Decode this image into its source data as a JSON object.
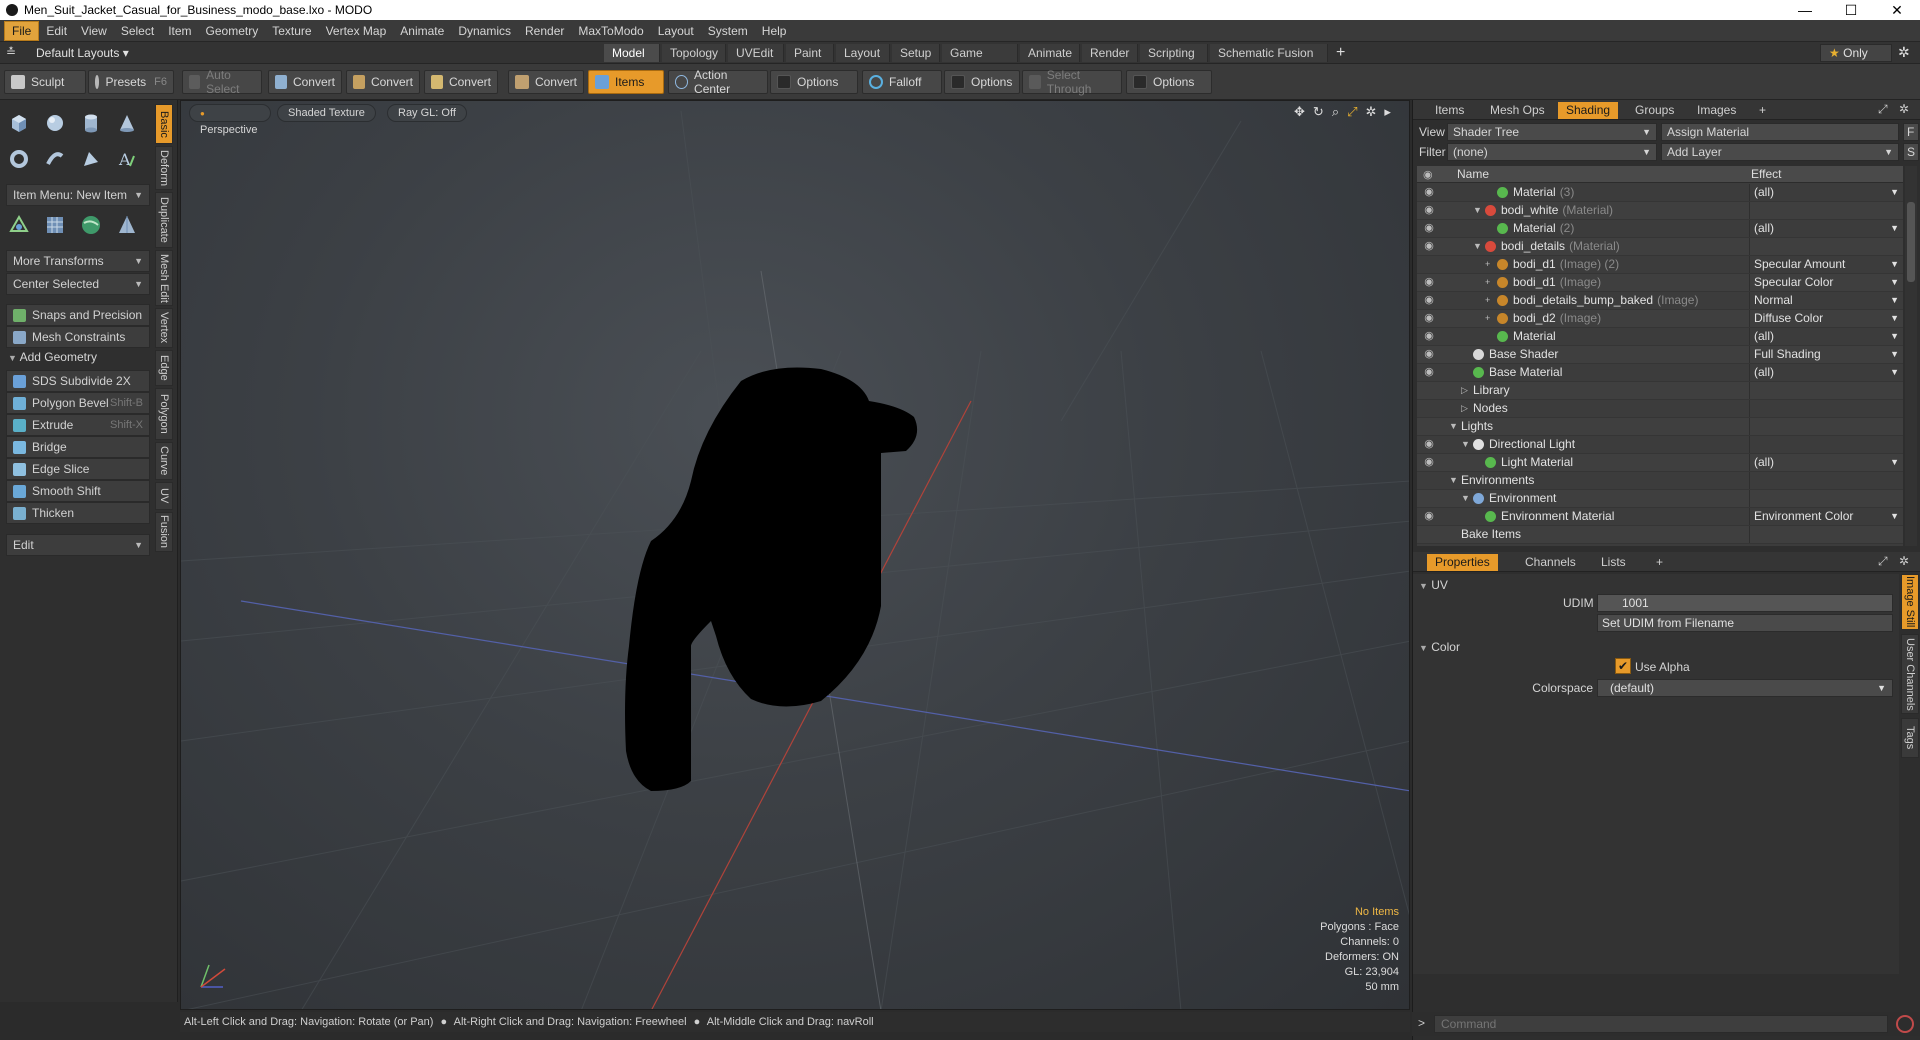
{
  "window": {
    "title": "Men_Suit_Jacket_Casual_for_Business_modo_base.lxo - MODO"
  },
  "menu": [
    "File",
    "Edit",
    "View",
    "Select",
    "Item",
    "Geometry",
    "Texture",
    "Vertex Map",
    "Animate",
    "Dynamics",
    "Render",
    "MaxToModo",
    "Layout",
    "System",
    "Help"
  ],
  "layout": {
    "preset": "Default Layouts",
    "tabs": [
      "Model",
      "Topology",
      "UVEdit",
      "Paint",
      "Layout",
      "Setup",
      "Game Tools",
      "Animate",
      "Render",
      "Scripting",
      "Schematic Fusion"
    ],
    "selected_tab": "Model",
    "only_label": "Only"
  },
  "toolbar": {
    "sculpt": "Sculpt",
    "presets": "Presets",
    "presets_key": "F6",
    "auto_select": "Auto Select",
    "convert": "Convert",
    "items": "Items",
    "action_center": "Action Center",
    "options": "Options",
    "falloff": "Falloff",
    "select_through": "Select Through"
  },
  "left": {
    "item_menu": "Item Menu: New Item",
    "more_transforms": "More Transforms",
    "center_selected": "Center Selected",
    "snaps": "Snaps and Precision",
    "mesh_constraints": "Mesh Constraints",
    "add_geometry": "Add Geometry",
    "tools": [
      {
        "label": "SDS Subdivide 2X",
        "key": ""
      },
      {
        "label": "Polygon Bevel",
        "key": "Shift-B"
      },
      {
        "label": "Extrude",
        "key": "Shift-X"
      },
      {
        "label": "Bridge",
        "key": ""
      },
      {
        "label": "Edge Slice",
        "key": ""
      },
      {
        "label": "Smooth Shift",
        "key": ""
      },
      {
        "label": "Thicken",
        "key": ""
      }
    ],
    "edit": "Edit",
    "vtabs": [
      "Basic",
      "Deform",
      "Duplicate",
      "Mesh Edit",
      "Vertex",
      "Edge",
      "Polygon",
      "Curve",
      "UV",
      "Fusion"
    ]
  },
  "viewport": {
    "view": "Perspective",
    "shading": "Shaded Texture",
    "raygl": "Ray GL: Off",
    "info": {
      "items": "No Items",
      "polygons": "Polygons : Face",
      "channels": "Channels: 0",
      "deformers": "Deformers: ON",
      "gl": "GL: 23,904",
      "scale": "50 mm"
    }
  },
  "status": {
    "hint1": "Alt-Left Click and Drag: Navigation: Rotate (or Pan)",
    "hint2": "Alt-Right Click and Drag: Navigation: Freewheel",
    "hint3": "Alt-Middle Click and Drag: navRoll"
  },
  "shading": {
    "tabs": [
      "Items",
      "Mesh Ops",
      "Shading",
      "Groups",
      "Images"
    ],
    "selected_tab": "Shading",
    "view_label": "View",
    "view_value": "Shader Tree",
    "assign_material": "Assign Material",
    "filter_label": "Filter",
    "filter_value": "(none)",
    "add_layer": "Add Layer",
    "f_label": "F",
    "s_label": "S",
    "col_name": "Name",
    "col_effect": "Effect",
    "rows": [
      {
        "name": "Material",
        "type": "(3)",
        "effect": "(all)",
        "indent": 3,
        "dot": "#58b84e",
        "eye": true,
        "tw": ""
      },
      {
        "name": "bodi_white",
        "type": "(Material)",
        "effect": "",
        "indent": 2,
        "dot": "#d84a3c",
        "eye": true,
        "tw": "▼"
      },
      {
        "name": "Material",
        "type": "(2)",
        "effect": "(all)",
        "indent": 3,
        "dot": "#58b84e",
        "eye": true,
        "tw": ""
      },
      {
        "name": "bodi_details",
        "type": "(Material)",
        "effect": "",
        "indent": 2,
        "dot": "#d84a3c",
        "eye": true,
        "tw": "▼"
      },
      {
        "name": "bodi_d1",
        "type": "(Image) (2)",
        "effect": "Specular Amount",
        "indent": 3,
        "dot": "#c7862a",
        "eye": false,
        "tw": "+"
      },
      {
        "name": "bodi_d1",
        "type": "(Image)",
        "effect": "Specular Color",
        "indent": 3,
        "dot": "#c7862a",
        "eye": true,
        "tw": "+"
      },
      {
        "name": "bodi_details_bump_baked",
        "type": "(Image)",
        "effect": "Normal",
        "indent": 3,
        "dot": "#c7862a",
        "eye": true,
        "tw": "+"
      },
      {
        "name": "bodi_d2",
        "type": "(Image)",
        "effect": "Diffuse Color",
        "indent": 3,
        "dot": "#c7862a",
        "eye": true,
        "tw": "+"
      },
      {
        "name": "Material",
        "type": "",
        "effect": "(all)",
        "indent": 3,
        "dot": "#58b84e",
        "eye": true,
        "tw": ""
      },
      {
        "name": "Base Shader",
        "type": "",
        "effect": "Full Shading",
        "indent": 1,
        "dot": "#d8d8d8",
        "eye": true,
        "tw": ""
      },
      {
        "name": "Base Material",
        "type": "",
        "effect": "(all)",
        "indent": 1,
        "dot": "#58b84e",
        "eye": true,
        "tw": ""
      },
      {
        "name": "Library",
        "type": "",
        "effect": "",
        "indent": 1,
        "dot": "",
        "eye": false,
        "tw": "▷"
      },
      {
        "name": "Nodes",
        "type": "",
        "effect": "",
        "indent": 1,
        "dot": "",
        "eye": false,
        "tw": "▷"
      },
      {
        "name": "Lights",
        "type": "",
        "effect": "",
        "indent": 0,
        "dot": "",
        "eye": false,
        "tw": "▼"
      },
      {
        "name": "Directional Light",
        "type": "",
        "effect": "",
        "indent": 1,
        "dot": "#e0e0e0",
        "eye": true,
        "tw": "▼"
      },
      {
        "name": "Light Material",
        "type": "",
        "effect": "(all)",
        "indent": 2,
        "dot": "#58b84e",
        "eye": true,
        "tw": ""
      },
      {
        "name": "Environments",
        "type": "",
        "effect": "",
        "indent": 0,
        "dot": "",
        "eye": false,
        "tw": "▼"
      },
      {
        "name": "Environment",
        "type": "",
        "effect": "",
        "indent": 1,
        "dot": "#7fa8d8",
        "eye": false,
        "tw": "▼"
      },
      {
        "name": "Environment Material",
        "type": "",
        "effect": "Environment Color",
        "indent": 2,
        "dot": "#58b84e",
        "eye": true,
        "tw": ""
      },
      {
        "name": "Bake Items",
        "type": "",
        "effect": "",
        "indent": 0,
        "dot": "",
        "eye": false,
        "tw": ""
      }
    ]
  },
  "properties": {
    "tabs": [
      "Properties",
      "Channels",
      "Lists"
    ],
    "selected_tab": "Properties",
    "uv_section": "UV",
    "udim_label": "UDIM",
    "udim_value": "1001",
    "set_udim": "Set UDIM from Filename",
    "color_section": "Color",
    "use_alpha": "Use Alpha",
    "colorspace_label": "Colorspace",
    "colorspace_value": "(default)",
    "side_tabs": [
      "Image Still",
      "User Channels",
      "Tags"
    ]
  },
  "command": {
    "placeholder": "Command"
  },
  "colors": {
    "accent": "#e79a2a",
    "viewport_bg": "#3c4045",
    "panel": "#2e2e2e"
  }
}
